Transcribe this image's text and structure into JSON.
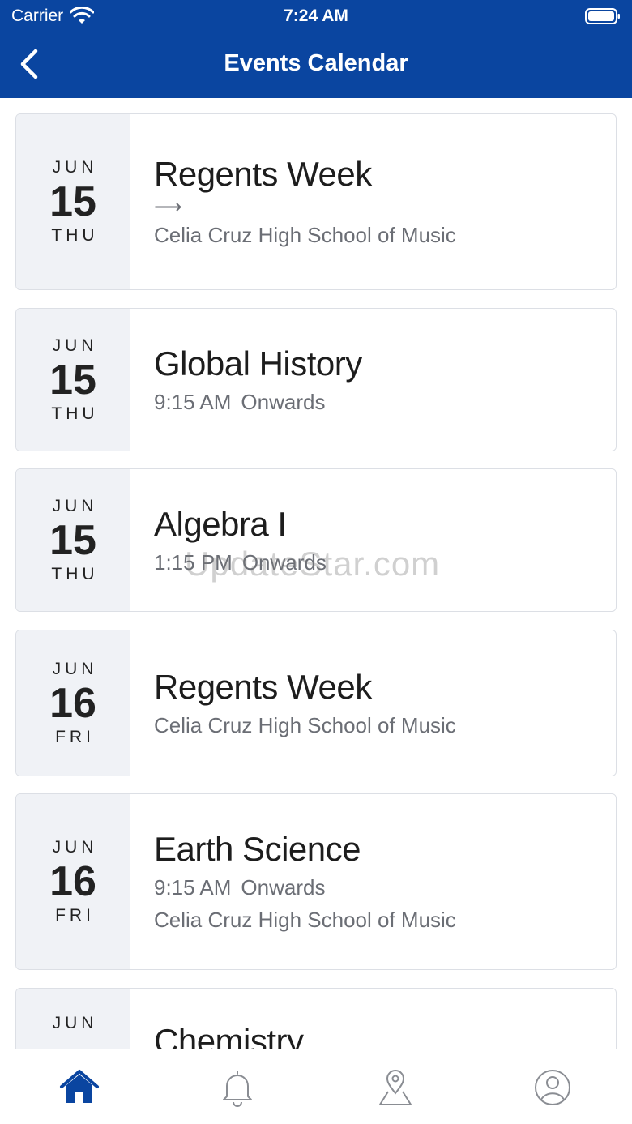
{
  "status": {
    "carrier": "Carrier",
    "time": "7:24 AM"
  },
  "header": {
    "title": "Events Calendar",
    "back_icon": "chevron-left-icon",
    "color": "#0a45a0"
  },
  "events": [
    {
      "month": "JUN",
      "day": "15",
      "weekday": "THU",
      "title": "Regents Week",
      "arrow": "⟶",
      "time": "",
      "time_suffix": "",
      "location": "Celia Cruz High School of Music"
    },
    {
      "month": "JUN",
      "day": "15",
      "weekday": "THU",
      "title": "Global History",
      "arrow": "",
      "time": "9:15 AM",
      "time_suffix": "Onwards",
      "location": ""
    },
    {
      "month": "JUN",
      "day": "15",
      "weekday": "THU",
      "title": "Algebra I",
      "arrow": "",
      "time": "1:15 PM",
      "time_suffix": "Onwards",
      "location": ""
    },
    {
      "month": "JUN",
      "day": "16",
      "weekday": "FRI",
      "title": "Regents Week",
      "arrow": "",
      "time": "",
      "time_suffix": "",
      "location": "Celia Cruz High School of Music"
    },
    {
      "month": "JUN",
      "day": "16",
      "weekday": "FRI",
      "title": "Earth Science",
      "arrow": "",
      "time": "9:15 AM",
      "time_suffix": "Onwards",
      "location": "Celia Cruz High School of Music"
    },
    {
      "month": "JUN",
      "day": "",
      "weekday": "",
      "title": "Chemistry",
      "arrow": "",
      "time": "",
      "time_suffix": "",
      "location": ""
    }
  ],
  "watermark": "UpdateStar.com",
  "tabs": [
    {
      "name": "home",
      "icon": "home-icon",
      "active": true
    },
    {
      "name": "notifications",
      "icon": "bell-icon",
      "active": false
    },
    {
      "name": "map",
      "icon": "map-pin-icon",
      "active": false
    },
    {
      "name": "profile",
      "icon": "user-icon",
      "active": false
    }
  ],
  "colors": {
    "active_tab": "#0a45a0",
    "inactive_tab": "#8a8d93"
  }
}
